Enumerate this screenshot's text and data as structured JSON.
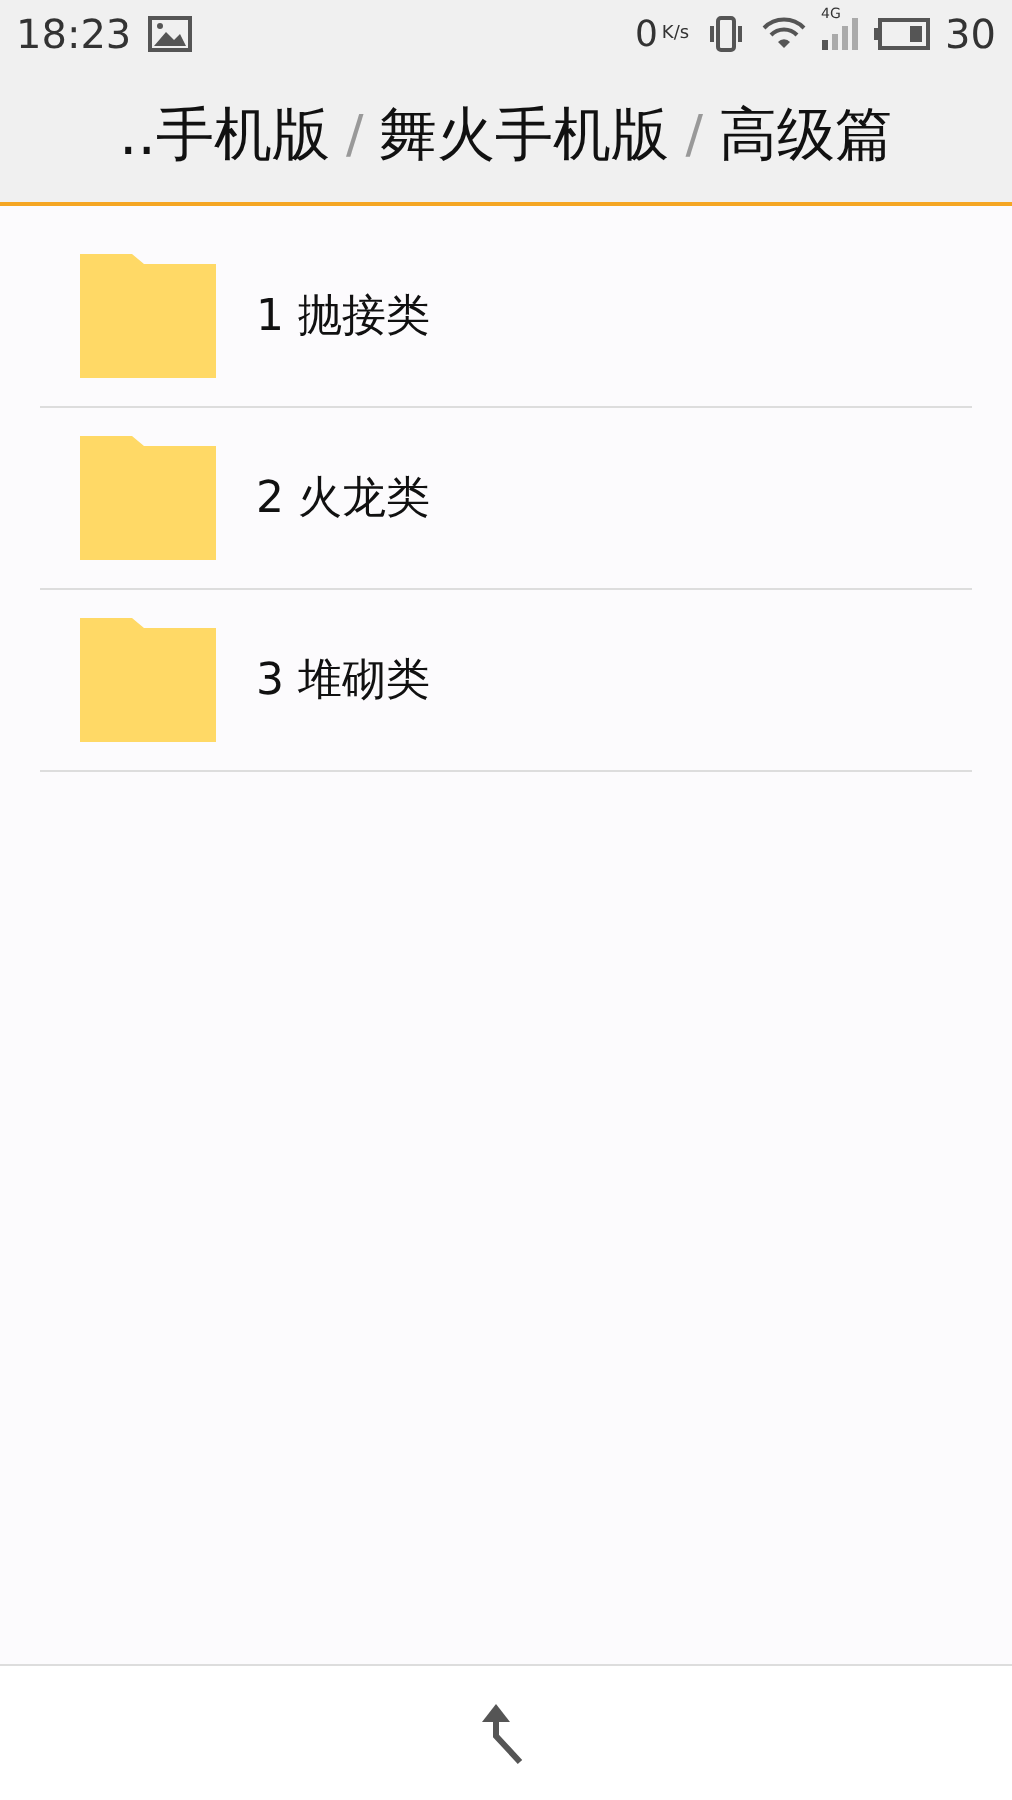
{
  "status_bar": {
    "time": "18:23",
    "speed": "0",
    "speed_unit": "K/s",
    "network": "4G",
    "battery_text": "30"
  },
  "breadcrumb": [
    {
      "label": "..手机版"
    },
    {
      "label": "舞火手机版"
    },
    {
      "label": "高级篇"
    }
  ],
  "separator": "/",
  "folders": [
    {
      "name": "1 抛接类"
    },
    {
      "name": "2 火龙类"
    },
    {
      "name": "3 堆砌类"
    }
  ]
}
